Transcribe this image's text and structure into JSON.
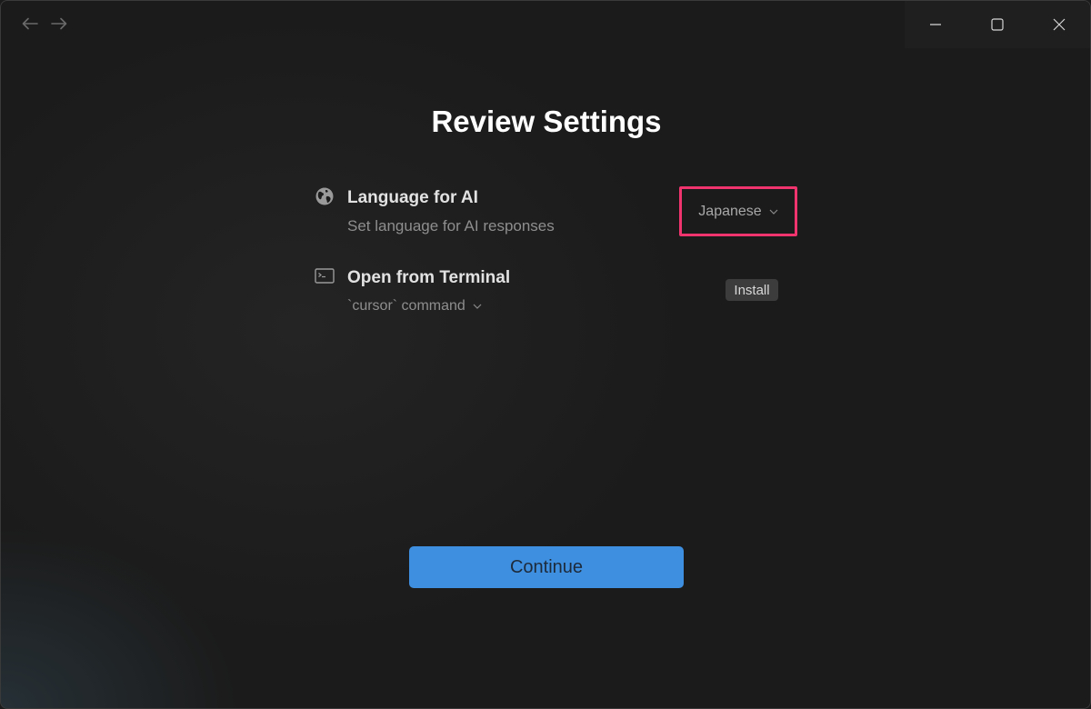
{
  "window": {
    "nav": {
      "back_icon": "arrow-left-icon",
      "forward_icon": "arrow-right-icon"
    },
    "controls": {
      "minimize_icon": "minimize-icon",
      "maximize_icon": "maximize-icon",
      "close_icon": "close-icon"
    }
  },
  "page": {
    "title": "Review Settings"
  },
  "settings": [
    {
      "icon": "globe-icon",
      "title": "Language for AI",
      "description": "Set language for AI responses",
      "select_value": "Japanese"
    },
    {
      "icon": "terminal-icon",
      "title": "Open from Terminal",
      "select_value": "`cursor` command",
      "button_label": "Install"
    }
  ],
  "footer": {
    "continue_label": "Continue"
  },
  "colors": {
    "accent": "#3f8fe0",
    "highlight": "#f0356e",
    "background": "#1b1b1b"
  }
}
